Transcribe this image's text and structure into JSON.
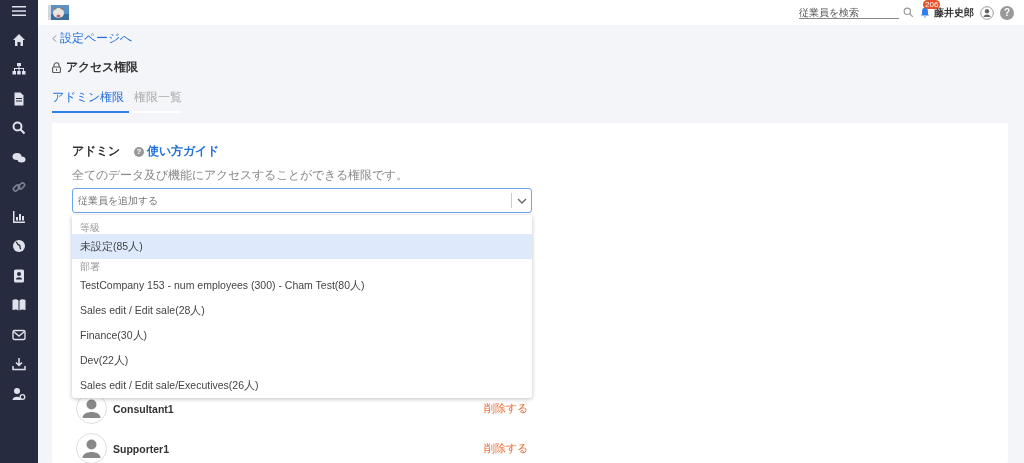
{
  "sidebar": {
    "items": [
      {
        "disabled": false
      },
      {
        "disabled": false
      },
      {
        "disabled": false
      },
      {
        "disabled": false
      },
      {
        "disabled": false
      },
      {
        "disabled": true
      },
      {
        "disabled": false
      },
      {
        "disabled": false
      },
      {
        "disabled": false
      },
      {
        "disabled": false
      },
      {
        "disabled": false
      },
      {
        "disabled": false
      },
      {
        "disabled": false
      }
    ]
  },
  "header": {
    "search": {
      "placeholder": "従業員を検索"
    },
    "notifications": "206",
    "user_name": "藤井史郎",
    "help": "?"
  },
  "back_link": "設定ページへ",
  "page_title": "アクセス権限",
  "tabs": [
    {
      "label": "アドミン権限",
      "selected": true
    },
    {
      "label": "権限一覧",
      "selected": false
    }
  ],
  "section": {
    "title": "アドミン",
    "guide_icon": "?",
    "guide_link": "使い方ガイド",
    "description": "全てのデータ及び機能にアクセスすることができる権限です。"
  },
  "employee_field": {
    "placeholder": "従業員を追加する"
  },
  "dropdown": {
    "groups": [
      {
        "label": "等級",
        "options": [
          {
            "label": "未設定(85人)",
            "selected": true
          }
        ]
      },
      {
        "label": "部署",
        "options": [
          {
            "label": "TestCompany 153 - num employees (300) - Cham Test(80人)",
            "selected": false
          },
          {
            "label": "Sales edit / Edit sale(28人)",
            "selected": false
          },
          {
            "label": "Finance(30人)",
            "selected": false
          },
          {
            "label": "Dev(22人)",
            "selected": false
          },
          {
            "label": "Sales edit / Edit sale/Executives(26人)",
            "selected": false
          }
        ]
      }
    ]
  },
  "members": [
    {
      "name": "Consultant1",
      "action": "削除する"
    },
    {
      "name": "Supporter1",
      "action": "削除する"
    }
  ]
}
